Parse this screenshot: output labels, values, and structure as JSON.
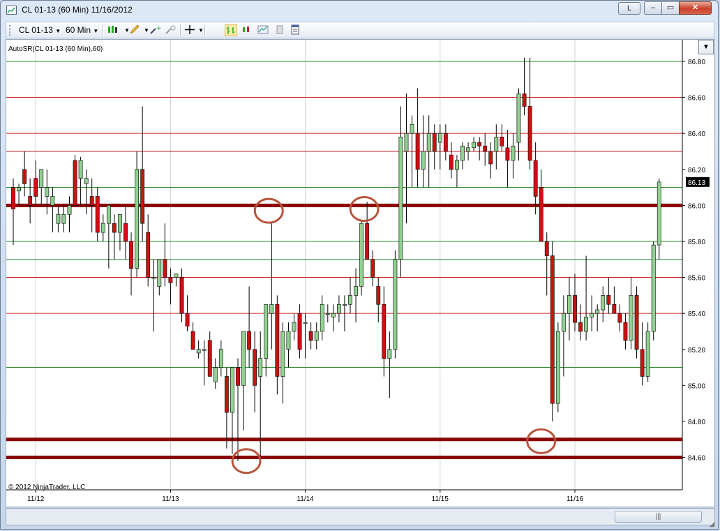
{
  "window": {
    "title": "CL 01-13 (60 Min)  11/16/2012",
    "buttons": {
      "layout": "L",
      "minimize": "–",
      "maximize": "▭",
      "close": "✕"
    }
  },
  "toolbar": {
    "instrument": "CL 01-13",
    "interval": "60 Min",
    "icons": [
      "candlestick-style-icon",
      "pencil-draw-icon",
      "add-indicator-icon",
      "remove-indicator-icon",
      "crosshair-icon",
      "bar-chart-icon",
      "candle-chart-icon",
      "line-chart-icon",
      "data-box-icon",
      "properties-icon"
    ]
  },
  "scroll_thumb_label": "|||",
  "colors": {
    "up_candle": "#90d090",
    "down_candle": "#cc1111",
    "wick": "#000000",
    "support_resistance_thick": "#8b0000",
    "red_line": "#cc2222",
    "green_line": "#2a8a2a",
    "annotation": "#b8543c",
    "grid": "#cfcfcf"
  },
  "chart_data": {
    "type": "candlestick",
    "indicator_label": "AutoSR(CL 01-13 (60 Min),60)",
    "copyright": "© 2012 NinjaTrader, LLC",
    "last_price": "86.13",
    "ylim": [
      84.42,
      86.92
    ],
    "y_ticks": [
      "84.60",
      "84.80",
      "85.00",
      "85.20",
      "85.40",
      "85.60",
      "85.80",
      "86.00",
      "86.20",
      "86.40",
      "86.60",
      "86.80"
    ],
    "x_ticks": [
      {
        "label": "11/12",
        "index": 4
      },
      {
        "label": "11/13",
        "index": 28
      },
      {
        "label": "11/14",
        "index": 52
      },
      {
        "label": "11/15",
        "index": 76
      },
      {
        "label": "11/16",
        "index": 100
      }
    ],
    "candle_count": 114,
    "levels": [
      {
        "value": 86.0,
        "style": "thick"
      },
      {
        "value": 84.7,
        "style": "thick"
      },
      {
        "value": 84.6,
        "style": "thick"
      },
      {
        "value": 86.6,
        "style": "red"
      },
      {
        "value": 86.4,
        "style": "red"
      },
      {
        "value": 86.3,
        "style": "red"
      },
      {
        "value": 85.6,
        "style": "red"
      },
      {
        "value": 85.4,
        "style": "red"
      },
      {
        "value": 86.8,
        "style": "green"
      },
      {
        "value": 86.1,
        "style": "green"
      },
      {
        "value": 85.8,
        "style": "green"
      },
      {
        "value": 85.7,
        "style": "green"
      },
      {
        "value": 85.1,
        "style": "green"
      }
    ],
    "annotations": [
      {
        "index": 45.5,
        "price": 85.97
      },
      {
        "index": 62.5,
        "price": 85.98
      },
      {
        "index": 41.5,
        "price": 84.58
      },
      {
        "index": 94,
        "price": 84.69
      }
    ],
    "candles": [
      [
        86.1,
        86.15,
        85.78,
        85.98
      ],
      [
        86.08,
        86.12,
        86.0,
        86.1
      ],
      [
        86.2,
        86.3,
        86.05,
        86.12
      ],
      [
        86.05,
        86.15,
        85.9,
        86.0
      ],
      [
        86.15,
        86.25,
        86.0,
        86.05
      ],
      [
        86.1,
        86.2,
        86.0,
        86.2
      ],
      [
        86.05,
        86.2,
        85.95,
        86.1
      ],
      [
        86.0,
        86.1,
        85.85,
        86.05
      ],
      [
        85.9,
        86.0,
        85.85,
        85.95
      ],
      [
        85.9,
        86.0,
        85.85,
        85.95
      ],
      [
        85.95,
        86.05,
        85.85,
        86.0
      ],
      [
        86.25,
        86.28,
        86.0,
        86.0
      ],
      [
        86.15,
        86.27,
        86.0,
        86.25
      ],
      [
        86.12,
        86.2,
        85.95,
        86.15
      ],
      [
        86.05,
        86.15,
        85.85,
        86.0
      ],
      [
        86.05,
        86.1,
        85.8,
        85.85
      ],
      [
        85.85,
        85.95,
        85.8,
        85.9
      ],
      [
        85.9,
        86.0,
        85.65,
        86.0
      ],
      [
        85.9,
        85.95,
        85.7,
        85.85
      ],
      [
        85.85,
        85.9,
        85.75,
        85.95
      ],
      [
        85.9,
        86.0,
        85.7,
        85.8
      ],
      [
        85.8,
        85.85,
        85.5,
        85.65
      ],
      [
        85.65,
        86.3,
        85.6,
        86.2
      ],
      [
        86.2,
        86.55,
        85.8,
        85.9
      ],
      [
        85.85,
        85.95,
        85.55,
        85.6
      ],
      [
        85.6,
        85.7,
        85.3,
        85.6
      ],
      [
        85.55,
        85.7,
        85.5,
        85.7
      ],
      [
        85.7,
        85.9,
        85.55,
        85.6
      ],
      [
        85.6,
        85.65,
        85.45,
        85.57
      ],
      [
        85.6,
        85.62,
        85.55,
        85.62
      ],
      [
        85.6,
        85.65,
        85.35,
        85.4
      ],
      [
        85.4,
        85.5,
        85.3,
        85.33
      ],
      [
        85.3,
        85.35,
        85.2,
        85.2
      ],
      [
        85.18,
        85.25,
        85.15,
        85.2
      ],
      [
        85.2,
        85.25,
        85.0,
        85.2
      ],
      [
        85.25,
        85.3,
        85.05,
        85.05
      ],
      [
        85.02,
        85.15,
        84.98,
        85.1
      ],
      [
        85.1,
        85.25,
        85.05,
        85.2
      ],
      [
        85.05,
        85.1,
        84.65,
        84.85
      ],
      [
        84.85,
        85.0,
        84.62,
        85.1
      ],
      [
        85.1,
        85.15,
        84.58,
        85.0
      ],
      [
        85.0,
        85.2,
        84.75,
        85.3
      ],
      [
        85.3,
        85.55,
        85.1,
        85.2
      ],
      [
        85.2,
        85.3,
        84.85,
        85.0
      ],
      [
        85.05,
        85.3,
        84.57,
        85.15
      ],
      [
        85.15,
        85.45,
        85.05,
        85.45
      ],
      [
        85.4,
        85.9,
        85.2,
        85.45
      ],
      [
        85.45,
        85.5,
        84.95,
        85.05
      ],
      [
        85.05,
        85.35,
        84.9,
        85.3
      ],
      [
        85.2,
        85.35,
        85.1,
        85.3
      ],
      [
        85.3,
        85.4,
        85.25,
        85.35
      ],
      [
        85.4,
        85.45,
        85.15,
        85.2
      ],
      [
        85.35,
        85.4,
        85.15,
        85.35
      ],
      [
        85.3,
        85.35,
        85.2,
        85.25
      ],
      [
        85.25,
        85.35,
        85.2,
        85.3
      ],
      [
        85.3,
        85.5,
        85.25,
        85.45
      ],
      [
        85.4,
        85.45,
        85.35,
        85.4
      ],
      [
        85.38,
        85.45,
        85.3,
        85.4
      ],
      [
        85.4,
        85.5,
        85.35,
        85.45
      ],
      [
        85.45,
        85.5,
        85.3,
        85.45
      ],
      [
        85.45,
        85.6,
        85.4,
        85.5
      ],
      [
        85.5,
        85.65,
        85.35,
        85.55
      ],
      [
        85.55,
        85.92,
        85.5,
        85.9
      ],
      [
        85.9,
        86.02,
        85.7,
        85.7
      ],
      [
        85.7,
        85.75,
        85.55,
        85.6
      ],
      [
        85.55,
        85.6,
        85.35,
        85.45
      ],
      [
        85.45,
        85.55,
        85.05,
        85.15
      ],
      [
        85.15,
        85.3,
        84.93,
        85.2
      ],
      [
        85.2,
        85.75,
        85.15,
        85.7
      ],
      [
        85.7,
        86.55,
        85.6,
        86.38
      ],
      [
        86.3,
        86.62,
        85.9,
        86.4
      ],
      [
        86.4,
        86.5,
        86.1,
        86.45
      ],
      [
        86.4,
        86.65,
        86.1,
        86.2
      ],
      [
        86.2,
        86.5,
        86.1,
        86.3
      ],
      [
        86.3,
        86.5,
        86.1,
        86.4
      ],
      [
        86.4,
        86.45,
        86.2,
        86.3
      ],
      [
        86.35,
        86.45,
        86.2,
        86.4
      ],
      [
        86.4,
        86.45,
        86.25,
        86.3
      ],
      [
        86.28,
        86.35,
        86.15,
        86.2
      ],
      [
        86.2,
        86.28,
        86.1,
        86.25
      ],
      [
        86.25,
        86.35,
        86.2,
        86.33
      ],
      [
        86.3,
        86.35,
        86.25,
        86.32
      ],
      [
        86.32,
        86.38,
        86.3,
        86.35
      ],
      [
        86.35,
        86.38,
        86.25,
        86.33
      ],
      [
        86.33,
        86.4,
        86.22,
        86.3
      ],
      [
        86.3,
        86.35,
        86.15,
        86.23
      ],
      [
        86.3,
        86.45,
        86.2,
        86.38
      ],
      [
        86.38,
        86.45,
        86.3,
        86.33
      ],
      [
        86.32,
        86.42,
        86.1,
        86.25
      ],
      [
        86.25,
        86.4,
        86.15,
        86.33
      ],
      [
        86.35,
        86.65,
        86.25,
        86.62
      ],
      [
        86.62,
        86.82,
        86.5,
        86.55
      ],
      [
        86.55,
        86.82,
        86.2,
        86.25
      ],
      [
        86.25,
        86.35,
        85.95,
        86.05
      ],
      [
        86.1,
        86.2,
        85.8,
        85.8
      ],
      [
        85.8,
        85.85,
        85.5,
        85.72
      ],
      [
        85.72,
        85.8,
        84.8,
        84.9
      ],
      [
        84.9,
        85.35,
        84.85,
        85.3
      ],
      [
        85.3,
        85.5,
        85.05,
        85.4
      ],
      [
        85.4,
        85.6,
        85.25,
        85.5
      ],
      [
        85.5,
        85.62,
        85.3,
        85.35
      ],
      [
        85.35,
        85.45,
        85.25,
        85.3
      ],
      [
        85.3,
        85.72,
        85.25,
        85.38
      ],
      [
        85.38,
        85.5,
        85.3,
        85.4
      ],
      [
        85.4,
        85.45,
        85.3,
        85.42
      ],
      [
        85.42,
        85.55,
        85.35,
        85.5
      ],
      [
        85.5,
        85.6,
        85.4,
        85.45
      ],
      [
        85.45,
        85.55,
        85.4,
        85.4
      ],
      [
        85.4,
        85.45,
        85.3,
        85.35
      ],
      [
        85.35,
        85.4,
        85.2,
        85.25
      ],
      [
        85.25,
        85.6,
        85.2,
        85.5
      ],
      [
        85.5,
        85.55,
        85.15,
        85.2
      ],
      [
        85.2,
        85.35,
        85.0,
        85.05
      ],
      [
        85.05,
        85.35,
        85.02,
        85.3
      ],
      [
        85.3,
        85.8,
        85.25,
        85.78
      ],
      [
        85.78,
        86.15,
        85.7,
        86.13
      ]
    ]
  }
}
